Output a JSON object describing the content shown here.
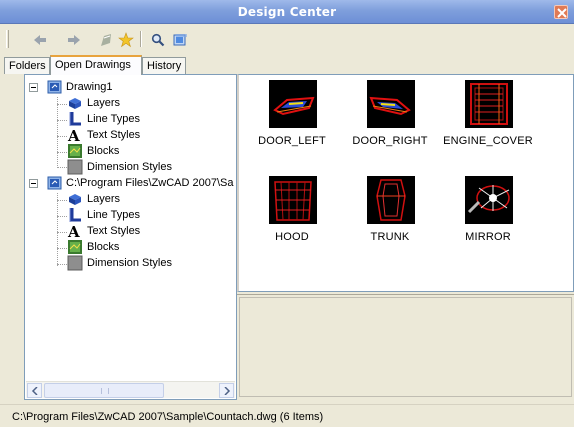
{
  "window": {
    "title": "Design Center"
  },
  "toolbar": {
    "buttons": [
      {
        "icon": "back-arrow-icon"
      },
      {
        "icon": "forward-arrow-icon"
      },
      {
        "icon": "up-folder-icon"
      },
      {
        "icon": "favorites-icon"
      },
      {
        "icon": "search-icon"
      },
      {
        "icon": "tree-toggle-icon"
      }
    ]
  },
  "tabs": [
    {
      "label": "Folders"
    },
    {
      "label": "Open Drawings",
      "active": true
    },
    {
      "label": "History"
    }
  ],
  "tree": {
    "drawing1": {
      "label": "Drawing1",
      "children": [
        "Layers",
        "Line Types",
        "Text Styles",
        "Blocks",
        "Dimension Styles"
      ]
    },
    "drawing2": {
      "label": "C:\\Program Files\\ZwCAD 2007\\Sa",
      "children": [
        "Layers",
        "Line Types",
        "Text Styles",
        "Blocks",
        "Dimension Styles"
      ]
    }
  },
  "content": {
    "items": [
      {
        "label": "DOOR_LEFT"
      },
      {
        "label": "DOOR_RIGHT"
      },
      {
        "label": "ENGINE_COVER"
      },
      {
        "label": "HOOD"
      },
      {
        "label": "TRUNK"
      },
      {
        "label": "MIRROR"
      }
    ]
  },
  "status": {
    "text": "C:\\Program Files\\ZwCAD 2007\\Sample\\Countach.dwg (6 Items)"
  },
  "colors": {
    "titlebar": "#7f9fdc",
    "tab_highlight": "#e8a33d",
    "panel_border": "#7f9db9",
    "chrome": "#ece9d8"
  }
}
